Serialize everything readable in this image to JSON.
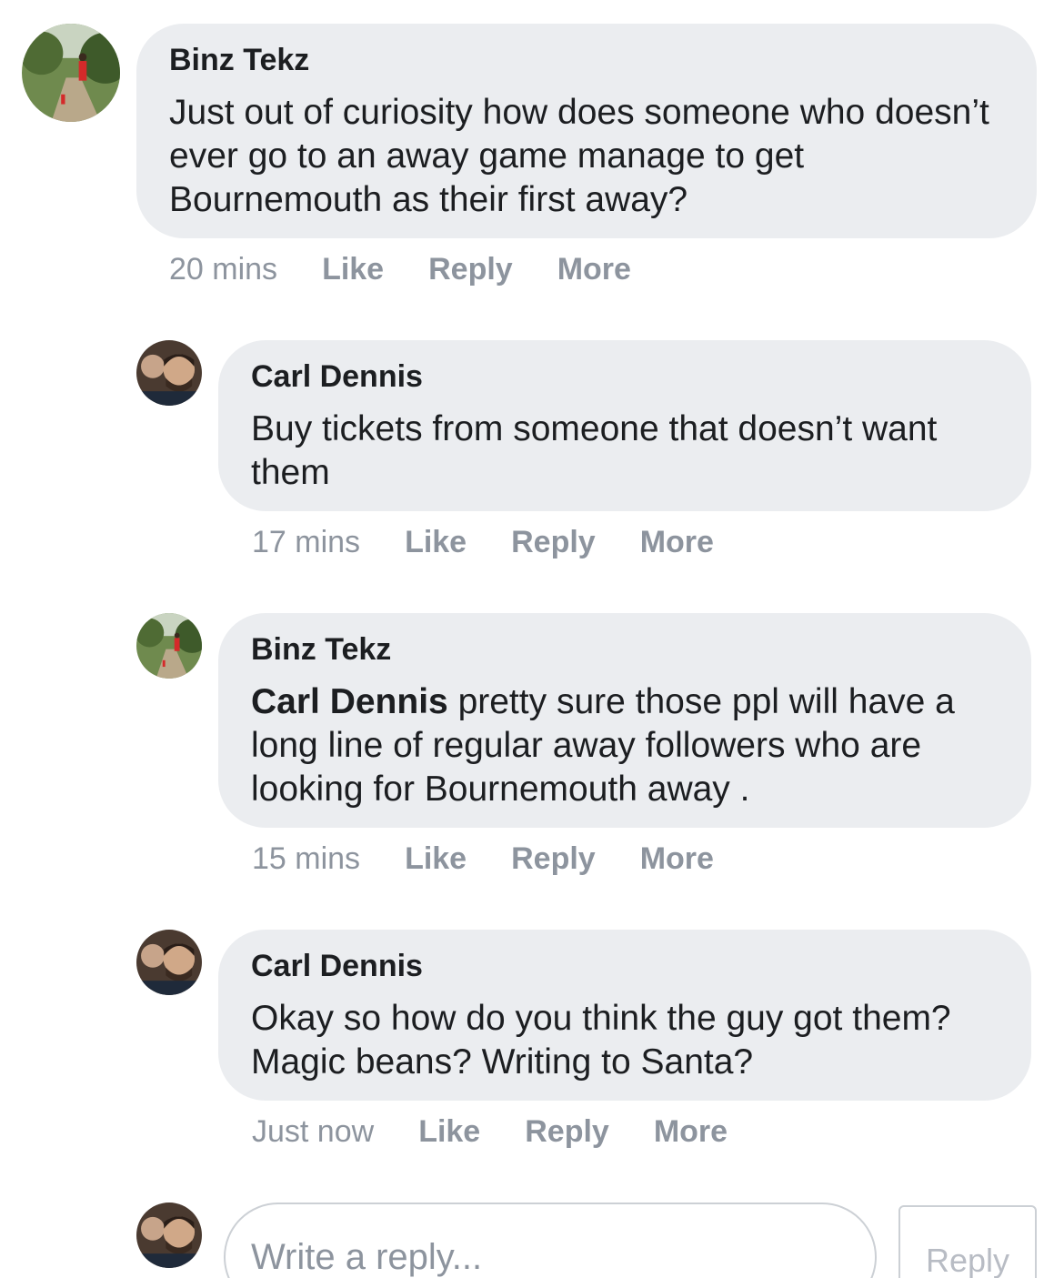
{
  "comments": [
    {
      "author": "Binz Tekz",
      "text": "Just out of curiosity how does someone who doesn’t ever go to an away game manage to get Bournemouth as their first away?",
      "time": "20 mins",
      "like": "Like",
      "reply": "Reply",
      "more": "More",
      "avatar_icon": "outdoor-path-photo"
    },
    {
      "author": "Carl Dennis",
      "text": "Buy tickets from someone that doesn’t want them",
      "time": "17 mins",
      "like": "Like",
      "reply": "Reply",
      "more": "More",
      "avatar_icon": "man-portrait-photo"
    },
    {
      "author": "Binz Tekz",
      "mention": "Carl Dennis",
      "text": " pretty sure those ppl will have a long line of regular away followers who are looking for Bournemouth away .",
      "time": "15 mins",
      "like": "Like",
      "reply": "Reply",
      "more": "More",
      "avatar_icon": "outdoor-path-photo"
    },
    {
      "author": "Carl Dennis",
      "text": "Okay so how do you think the guy got them? Magic beans? Writing to Santa?",
      "time": "Just now",
      "like": "Like",
      "reply": "Reply",
      "more": "More",
      "avatar_icon": "man-portrait-photo"
    }
  ],
  "composer": {
    "placeholder": "Write a reply...",
    "button": "Reply",
    "avatar_icon": "man-portrait-photo"
  },
  "colors": {
    "bubble": "#ebedf0",
    "meta": "#8d949e",
    "text": "#1c1e21"
  }
}
